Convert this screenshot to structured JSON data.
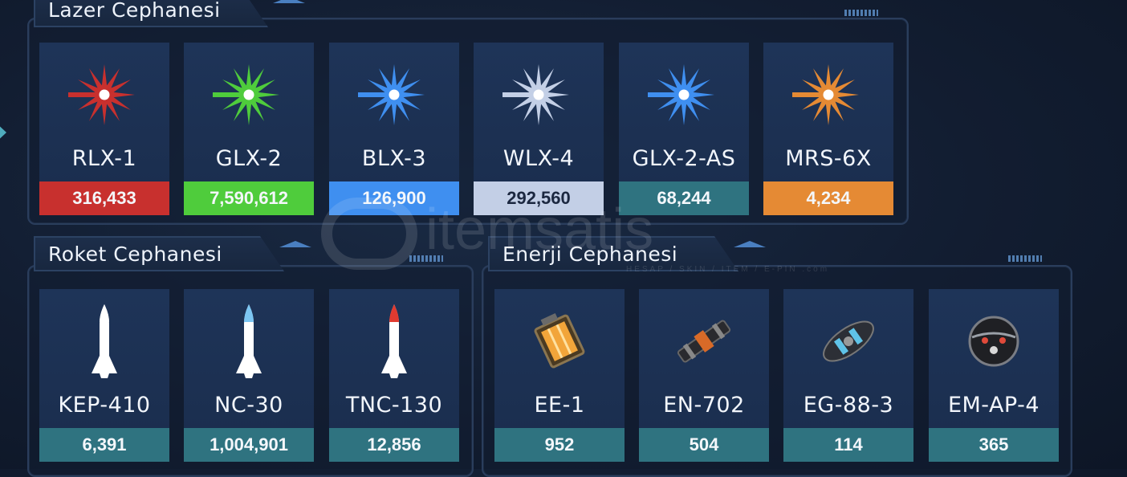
{
  "sections": {
    "laser": {
      "title": "Lazer Cephanesi",
      "items": [
        {
          "name": "RLX-1",
          "count": "316,433",
          "color": "#c8302e"
        },
        {
          "name": "GLX-2",
          "count": "7,590,612",
          "color": "#4fcc3c"
        },
        {
          "name": "BLX-3",
          "count": "126,900",
          "color": "#3f8ff0"
        },
        {
          "name": "WLX-4",
          "count": "292,560",
          "color": "#c3cfe6"
        },
        {
          "name": "GLX-2-AS",
          "count": "68,244",
          "color": "#2f7380"
        },
        {
          "name": "MRS-6X",
          "count": "4,234",
          "color": "#e58a34"
        }
      ]
    },
    "rocket": {
      "title": "Roket Cephanesi",
      "items": [
        {
          "name": "KEP-410",
          "count": "6,391",
          "tip": "#ffffff"
        },
        {
          "name": "NC-30",
          "count": "1,004,901",
          "tip": "#7cc6f2"
        },
        {
          "name": "TNC-130",
          "count": "12,856",
          "tip": "#e03a30"
        }
      ]
    },
    "energy": {
      "title": "Enerji Cephanesi",
      "items": [
        {
          "name": "EE-1",
          "count": "952",
          "icon": "battery-cell-icon"
        },
        {
          "name": "EN-702",
          "count": "504",
          "icon": "energy-canister-icon"
        },
        {
          "name": "EG-88-3",
          "count": "114",
          "icon": "energy-generator-icon"
        },
        {
          "name": "EM-AP-4",
          "count": "365",
          "icon": "energy-orb-icon"
        }
      ]
    }
  },
  "watermark": {
    "brand": "itemsatis",
    "tagline": "HESAP / SKIN / ITEM / E-PIN",
    "suffix": ".com"
  },
  "count_bar_color": "#2f7380"
}
